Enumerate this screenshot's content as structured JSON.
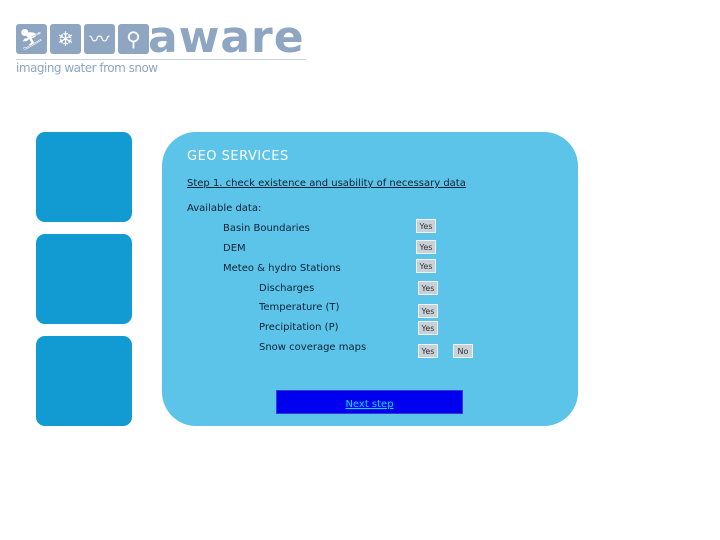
{
  "logo": {
    "wordmark": "aware",
    "tagline": "imaging water from snow",
    "icons": [
      "skier-icon",
      "snowflake-icon",
      "hydrograph-icon",
      "faucet-icon"
    ]
  },
  "panel": {
    "title": "GEO SERVICES",
    "step_link": "Step 1. check existence and usability of necessary data",
    "available_label": "Available data:",
    "items": [
      {
        "label": "Basin Boundaries",
        "yes": "Yes"
      },
      {
        "label": "DEM",
        "yes": "Yes"
      },
      {
        "label": "Meteo & hydro Stations",
        "yes": "Yes"
      },
      {
        "label": "Discharges",
        "yes": "Yes"
      },
      {
        "label": "Temperature (T)",
        "yes": "Yes"
      },
      {
        "label": "Precipitation (P)",
        "yes": "Yes"
      },
      {
        "label": "Snow coverage maps",
        "yes": "Yes",
        "no": "No"
      }
    ],
    "next_step": "Next step"
  },
  "colors": {
    "panel": "#5cc3e9",
    "side_blocks": "#129ad3",
    "next_button": "#0000f0",
    "logo": "#8fa6c2"
  }
}
